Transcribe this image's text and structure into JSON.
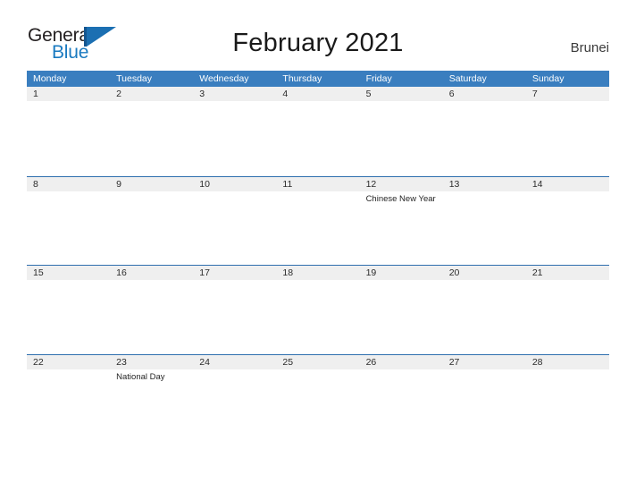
{
  "brand": {
    "name_part1": "General",
    "name_part2": "Blue",
    "mark": "triangle-logo-icon",
    "color_dark": "#231f20",
    "color_blue": "#1a7ac0"
  },
  "header": {
    "title": "February 2021",
    "country": "Brunei"
  },
  "theme": {
    "header_blue": "#3a7ebf",
    "row_line_blue": "#2f6fae",
    "date_band_gray": "#efefef",
    "page_background": "#ffffff"
  },
  "calendar": {
    "month": "February",
    "year": "2021",
    "weekday_headers": [
      "Monday",
      "Tuesday",
      "Wednesday",
      "Thursday",
      "Friday",
      "Saturday",
      "Sunday"
    ],
    "weeks": [
      {
        "days": [
          {
            "num": "1",
            "events": []
          },
          {
            "num": "2",
            "events": []
          },
          {
            "num": "3",
            "events": []
          },
          {
            "num": "4",
            "events": []
          },
          {
            "num": "5",
            "events": []
          },
          {
            "num": "6",
            "events": []
          },
          {
            "num": "7",
            "events": []
          }
        ]
      },
      {
        "days": [
          {
            "num": "8",
            "events": []
          },
          {
            "num": "9",
            "events": []
          },
          {
            "num": "10",
            "events": []
          },
          {
            "num": "11",
            "events": []
          },
          {
            "num": "12",
            "events": [
              "Chinese New Year"
            ]
          },
          {
            "num": "13",
            "events": []
          },
          {
            "num": "14",
            "events": []
          }
        ]
      },
      {
        "days": [
          {
            "num": "15",
            "events": []
          },
          {
            "num": "16",
            "events": []
          },
          {
            "num": "17",
            "events": []
          },
          {
            "num": "18",
            "events": []
          },
          {
            "num": "19",
            "events": []
          },
          {
            "num": "20",
            "events": []
          },
          {
            "num": "21",
            "events": []
          }
        ]
      },
      {
        "days": [
          {
            "num": "22",
            "events": []
          },
          {
            "num": "23",
            "events": [
              "National Day"
            ]
          },
          {
            "num": "24",
            "events": []
          },
          {
            "num": "25",
            "events": []
          },
          {
            "num": "26",
            "events": []
          },
          {
            "num": "27",
            "events": []
          },
          {
            "num": "28",
            "events": []
          }
        ]
      }
    ]
  }
}
